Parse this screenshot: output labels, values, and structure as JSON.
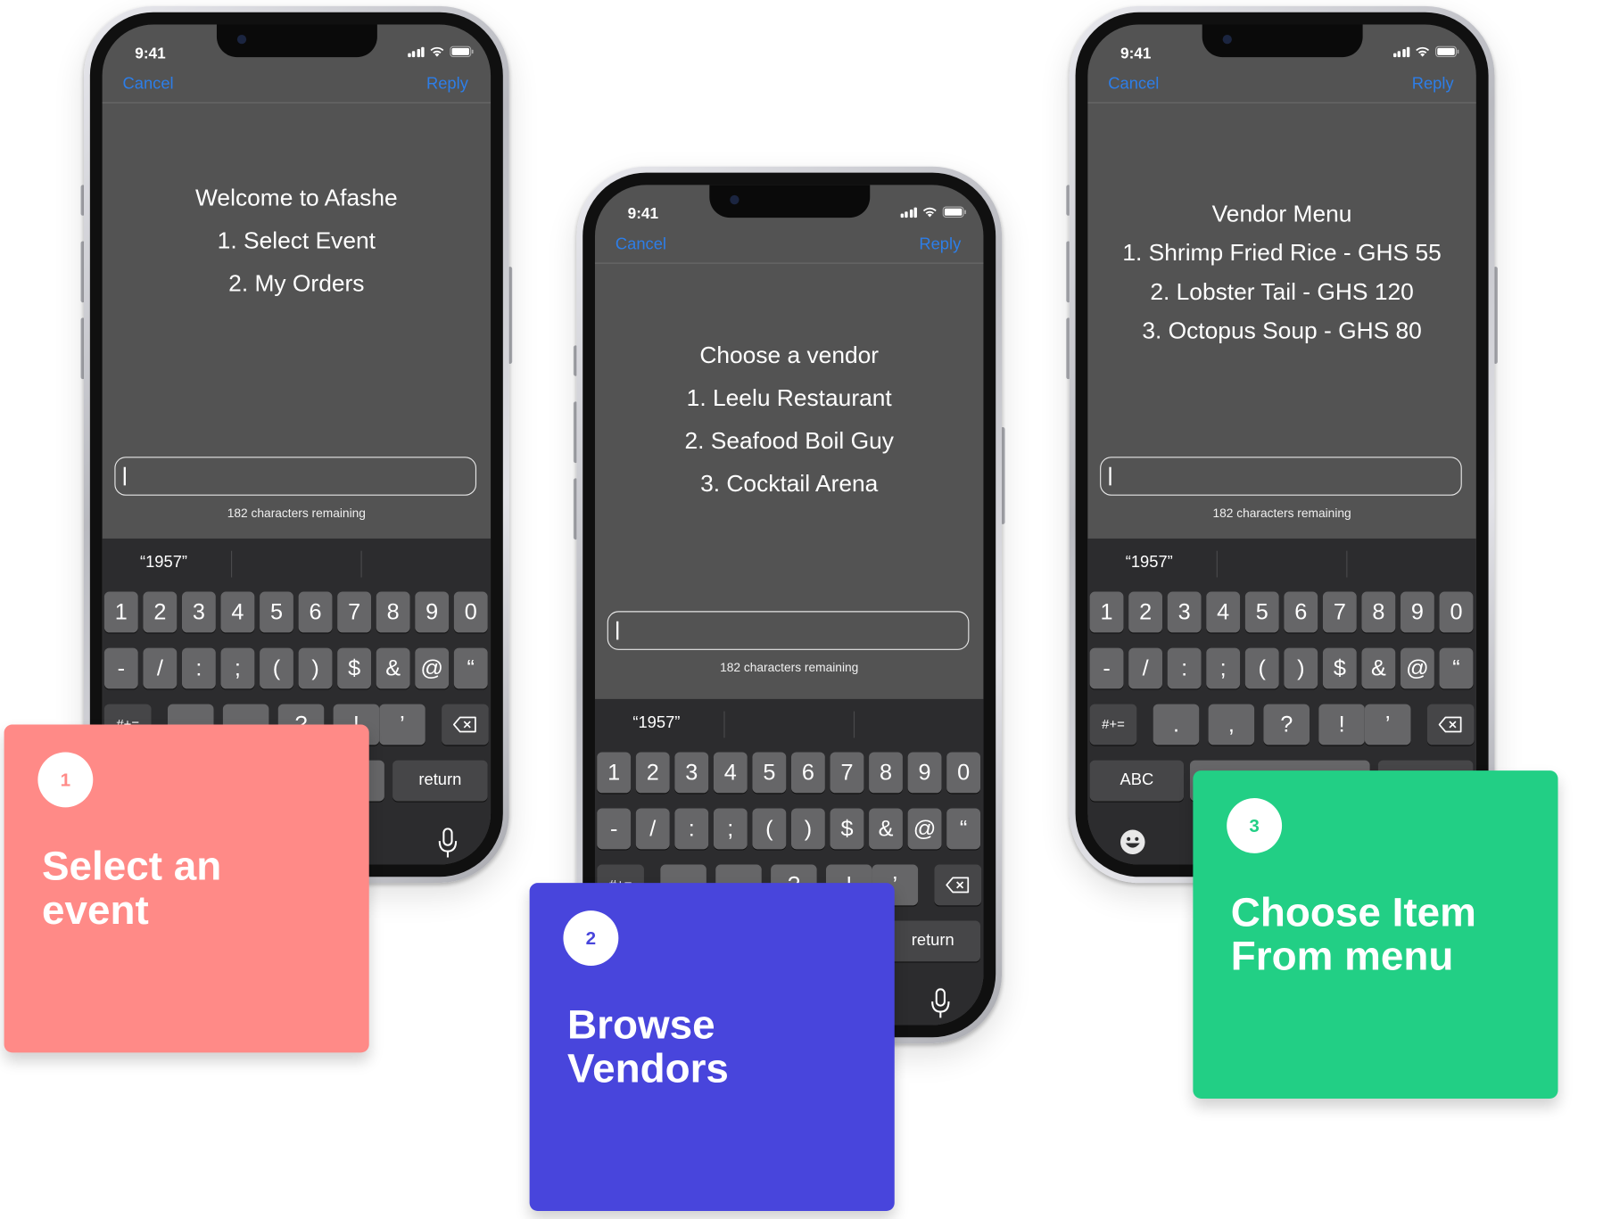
{
  "status_time": "9:41",
  "nav": {
    "cancel": "Cancel",
    "reply": "Reply"
  },
  "remaining": "182 characters remaining",
  "suggestion": "“1957”",
  "keys": {
    "row1": [
      "1",
      "2",
      "3",
      "4",
      "5",
      "6",
      "7",
      "8",
      "9",
      "0"
    ],
    "row2": [
      "-",
      "/",
      ":",
      ";",
      "(",
      ")",
      "$",
      "&",
      "@",
      "“"
    ],
    "row3_left": "#+=",
    "row3": [
      ".",
      ",",
      "?",
      "!",
      "’"
    ],
    "abc": "ABC",
    "return": "return"
  },
  "phones": [
    {
      "lines": [
        "Welcome to Afashe",
        "1. Select Event",
        "2. My Orders"
      ]
    },
    {
      "lines": [
        "Choose a vendor",
        "1. Leelu Restaurant",
        "2. Seafood Boil Guy",
        "3. Cocktail Arena"
      ]
    },
    {
      "lines": [
        "Vendor Menu",
        "1. Shrimp Fried Rice - GHS 55",
        "2. Lobster Tail - GHS 120",
        "3. Octopus Soup - GHS 80"
      ]
    }
  ],
  "cards": [
    {
      "number": "1",
      "title": "Select an event",
      "color": "#ff8a87"
    },
    {
      "number": "2",
      "title": "Browse Vendors",
      "color": "#4845dc"
    },
    {
      "number": "3",
      "title": "Choose Item From menu",
      "color": "#22cf85"
    }
  ],
  "colors": {
    "screen": "#535353",
    "keyboard": "#2c2c2e",
    "link": "#2d7ee8"
  }
}
